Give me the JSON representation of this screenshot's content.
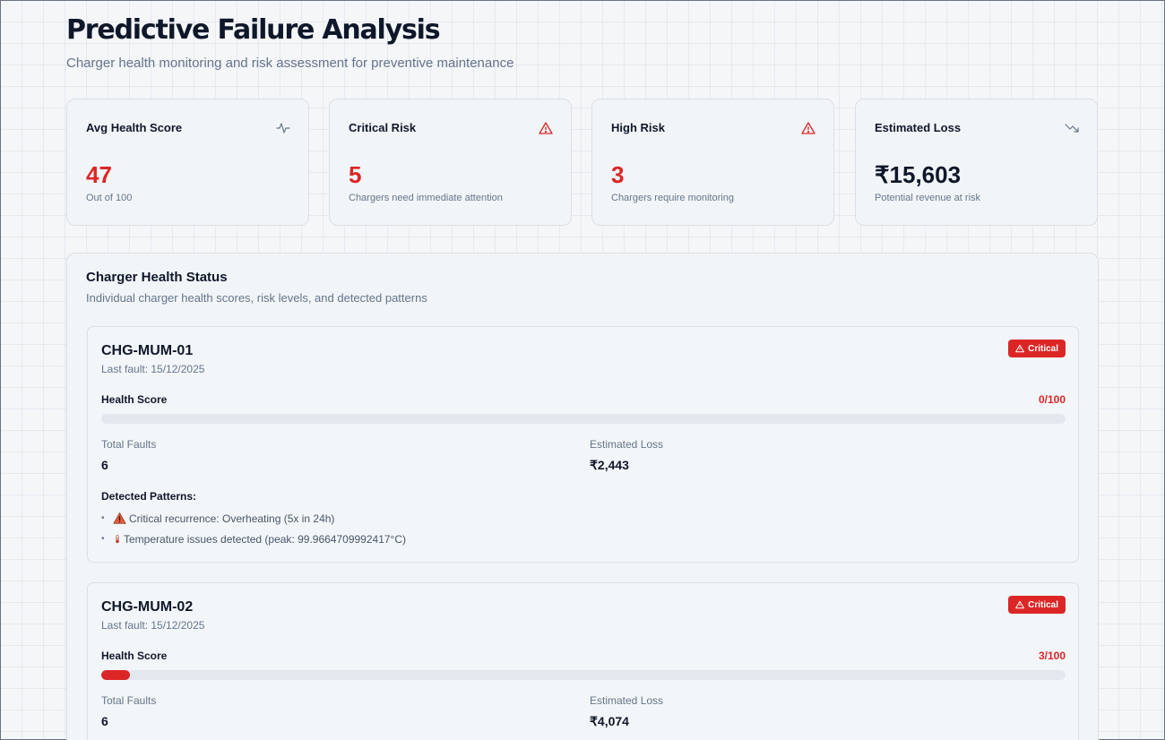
{
  "header": {
    "title": "Predictive Failure Analysis",
    "subtitle": "Charger health monitoring and risk assessment for preventive maintenance"
  },
  "stats": [
    {
      "label": "Avg Health Score",
      "value": "47",
      "sub": "Out of 100",
      "icon": "activity-icon"
    },
    {
      "label": "Critical Risk",
      "value": "5",
      "sub": "Chargers need immediate attention",
      "icon": "warning-icon"
    },
    {
      "label": "High Risk",
      "value": "3",
      "sub": "Chargers require monitoring",
      "icon": "warning-icon"
    },
    {
      "label": "Estimated Loss",
      "value": "₹15,603",
      "sub": "Potential revenue at risk",
      "icon": "trending-down-icon"
    }
  ],
  "panel": {
    "title": "Charger Health Status",
    "subtitle": "Individual charger health scores, risk levels, and detected patterns"
  },
  "labels": {
    "health_score": "Health Score",
    "total_faults": "Total Faults",
    "estimated_loss": "Estimated Loss",
    "detected_patterns": "Detected Patterns:"
  },
  "chargers": [
    {
      "id": "CHG-MUM-01",
      "last_fault": "Last fault: 15/12/2025",
      "risk": "Critical",
      "health_text": "0/100",
      "health_fraction": 0.0,
      "total_faults": "6",
      "estimated_loss": "₹2,443",
      "patterns": [
        "Critical recurrence: Overheating (5x in 24h)",
        "Temperature issues detected (peak: 99.9664709992417°C)"
      ]
    },
    {
      "id": "CHG-MUM-02",
      "last_fault": "Last fault: 15/12/2025",
      "risk": "Critical",
      "health_text": "3/100",
      "health_fraction": 0.03,
      "total_faults": "6",
      "estimated_loss": "₹4,074"
    }
  ],
  "colors": {
    "critical": "#dc2626",
    "text": "#0f172a",
    "muted": "#64748b",
    "card_bg": "#f2f5f7",
    "border": "#d9e0e6"
  }
}
